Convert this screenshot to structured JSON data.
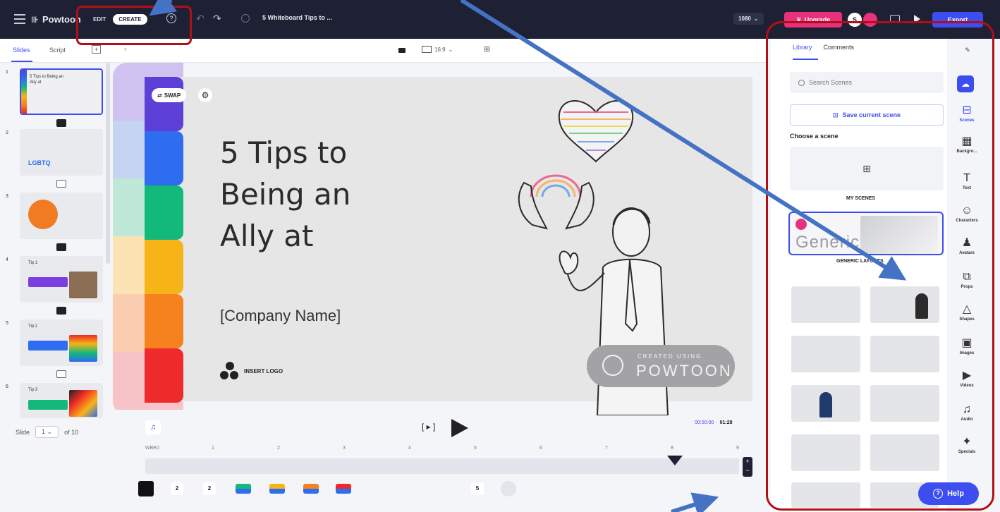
{
  "app": {
    "logo_text": "Powtoon",
    "mode_edit": "EDIT",
    "mode_create": "CREATE",
    "project_title": "5 Whiteboard Tips to ...",
    "resolution": "1080",
    "upgrade_label": "Upgrade",
    "avatar_initial": "S",
    "export_label": "Export"
  },
  "subbar": {
    "tab_slides": "Slides",
    "tab_script": "Script",
    "aspect_ratio": "16:9"
  },
  "thumbnails": [
    {
      "num": "1",
      "text": "5 Tips to Being an Ally at"
    },
    {
      "num": "2",
      "text": "",
      "badge": "LGBTQ"
    },
    {
      "num": "3",
      "text": ""
    },
    {
      "num": "4",
      "text": "Tip 1"
    },
    {
      "num": "5",
      "text": "Tip 2"
    },
    {
      "num": "6",
      "text": "Tip 3"
    }
  ],
  "slide_nav": {
    "label": "Slide",
    "current": "1",
    "of_text": "of 10"
  },
  "canvas": {
    "swap_label": "SWAP",
    "title": "5 Tips to\nBeing an\nAlly at",
    "company": "[Company Name]",
    "insert_logo": "INSERT LOGO",
    "watermark_small": "CREATED USING",
    "watermark_big": "POWTOON"
  },
  "timeline": {
    "scene_label": "[ ▸ ]",
    "current_time": "00:00:00",
    "total_time": "01:28",
    "ticks": [
      "WBE0",
      "1",
      "2",
      "3",
      "4",
      "5",
      "6",
      "7",
      "8",
      "9"
    ],
    "badges": [
      "2",
      "2",
      "5"
    ]
  },
  "library": {
    "tab_library": "Library",
    "tab_comments": "Comments",
    "search_placeholder": "Search Scenes",
    "save_scene": "Save current scene",
    "choose_scene": "Choose a scene",
    "my_scenes": "MY SCENES",
    "generic_text": "Generic",
    "generic_label": "GENERIC LAYOUTS"
  },
  "rail": [
    {
      "icon": "scenes-icon",
      "label": "Scenes"
    },
    {
      "icon": "backgrounds-icon",
      "label": "Backgro..."
    },
    {
      "icon": "text-icon",
      "label": "Text"
    },
    {
      "icon": "characters-icon",
      "label": "Characters"
    },
    {
      "icon": "avatars-icon",
      "label": "Avatars"
    },
    {
      "icon": "props-icon",
      "label": "Props"
    },
    {
      "icon": "shapes-icon",
      "label": "Shapes"
    },
    {
      "icon": "images-icon",
      "label": "Images"
    },
    {
      "icon": "videos-icon",
      "label": "Videos"
    },
    {
      "icon": "audio-icon",
      "label": "Audio"
    },
    {
      "icon": "specials-icon",
      "label": "Specials"
    }
  ],
  "help_label": "Help",
  "colors": {
    "accent": "#3d4ef0",
    "topbar": "#1d2133",
    "upgrade": "#e8317b",
    "highlight": "#b10f18",
    "annotation_arrow": "#4472c4",
    "rainbow": [
      "#cfc2f0",
      "#c4d4f2",
      "#bfe8d8",
      "#fbe3b3",
      "#fbcdb0",
      "#f7c3c6"
    ],
    "stripe": [
      "#5b3fd6",
      "#2e6cf0",
      "#13b97a",
      "#f6b416",
      "#f5821f",
      "#ee2a2a"
    ]
  }
}
